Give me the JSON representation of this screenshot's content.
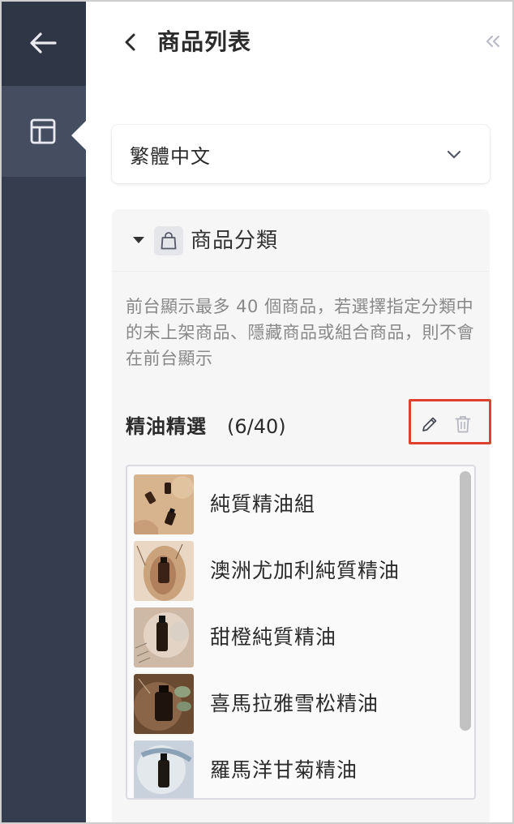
{
  "header": {
    "title": "商品列表"
  },
  "language_select": {
    "value": "繁體中文"
  },
  "section": {
    "title": "商品分類",
    "description": "前台顯示最多 40 個商品，若選擇指定分類中的未上架商品、隱藏商品或組合商品，則不會在前台顯示",
    "category": {
      "name": "精油精選",
      "count": "(6/40)"
    },
    "products": [
      {
        "name": "純質精油組"
      },
      {
        "name": "澳洲尤加利純質精油"
      },
      {
        "name": "甜橙純質精油"
      },
      {
        "name": "喜馬拉雅雪松精油"
      },
      {
        "name": "羅馬洋甘菊精油"
      }
    ]
  },
  "colors": {
    "rail_bg": "#363d4f",
    "rail_active": "#454d60",
    "highlight": "#e0412e",
    "section_bg": "#f6f6f7"
  },
  "icons": {
    "rail_back": "arrow-left-icon",
    "rail_layout": "layout-icon",
    "header_back": "chevron-left-icon",
    "collapse": "double-chevron-left-icon",
    "select": "chevron-down-icon",
    "section": "shopping-bag-icon",
    "edit": "pencil-icon",
    "delete": "trash-icon"
  }
}
